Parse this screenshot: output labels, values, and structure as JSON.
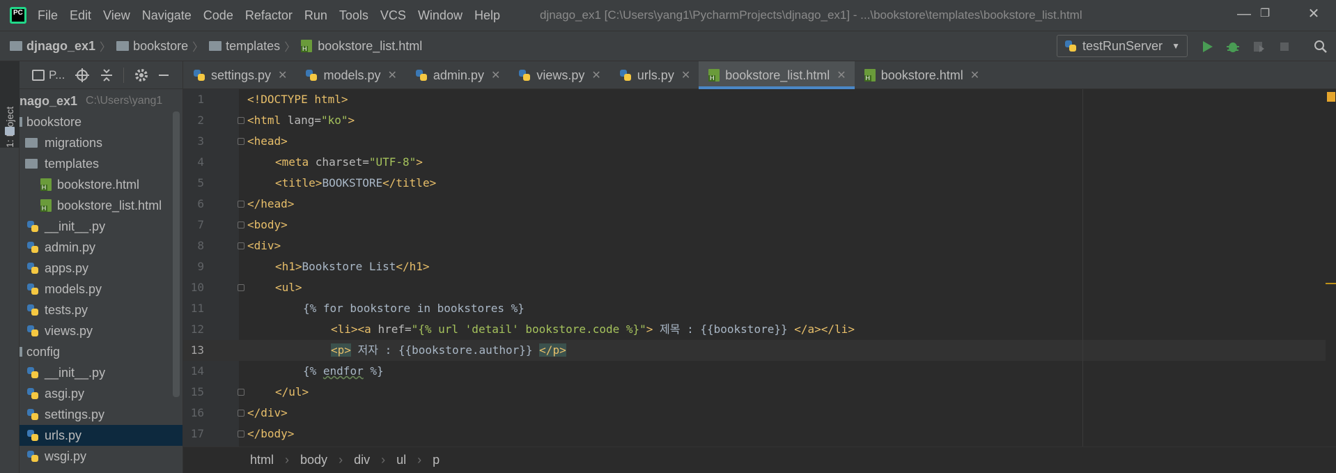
{
  "app": {
    "logo_text": "PC"
  },
  "menu": [
    "File",
    "Edit",
    "View",
    "Navigate",
    "Code",
    "Refactor",
    "Run",
    "Tools",
    "VCS",
    "Window",
    "Help"
  ],
  "window_title": "djnago_ex1 [C:\\Users\\yang1\\PycharmProjects\\djnago_ex1] - ...\\bookstore\\templates\\bookstore_list.html",
  "nav_breadcrumb": [
    "djnago_ex1",
    "bookstore",
    "templates",
    "bookstore_list.html"
  ],
  "run_config": "testRunServer",
  "project_panel": {
    "title": "P...",
    "side_tab": "1: Project",
    "root": {
      "name": "nago_ex1",
      "path": "C:\\Users\\yang1"
    },
    "items": [
      {
        "label": "bookstore",
        "type": "folder"
      },
      {
        "label": "migrations",
        "type": "folder"
      },
      {
        "label": "templates",
        "type": "folder"
      },
      {
        "label": "bookstore.html",
        "type": "html"
      },
      {
        "label": "bookstore_list.html",
        "type": "html"
      },
      {
        "label": "__init__.py",
        "type": "py"
      },
      {
        "label": "admin.py",
        "type": "py"
      },
      {
        "label": "apps.py",
        "type": "py"
      },
      {
        "label": "models.py",
        "type": "py"
      },
      {
        "label": "tests.py",
        "type": "py"
      },
      {
        "label": "views.py",
        "type": "py"
      },
      {
        "label": "config",
        "type": "folder"
      },
      {
        "label": "__init__.py",
        "type": "py"
      },
      {
        "label": "asgi.py",
        "type": "py"
      },
      {
        "label": "settings.py",
        "type": "py"
      },
      {
        "label": "urls.py",
        "type": "py"
      },
      {
        "label": "wsgi.py",
        "type": "py"
      }
    ]
  },
  "tabs": [
    {
      "label": "settings.py"
    },
    {
      "label": "models.py"
    },
    {
      "label": "admin.py"
    },
    {
      "label": "views.py"
    },
    {
      "label": "urls.py"
    },
    {
      "label": "bookstore_list.html"
    },
    {
      "label": "bookstore.html"
    }
  ],
  "line_numbers": [
    "1",
    "2",
    "3",
    "4",
    "5",
    "6",
    "7",
    "8",
    "9",
    "10",
    "11",
    "12",
    "13",
    "14",
    "15",
    "16",
    "17"
  ],
  "code": {
    "l1": "<!DOCTYPE html>",
    "l2a": "<html ",
    "l2b": "lang=",
    "l2c": "\"ko\"",
    "l2d": ">",
    "l3": "<head>",
    "l4a": "<meta ",
    "l4b": "charset=",
    "l4c": "\"UTF-8\"",
    "l4d": ">",
    "l5a": "<title>",
    "l5b": "BOOKSTORE",
    "l5c": "</title>",
    "l6": "</head>",
    "l7": "<body>",
    "l8": "<div>",
    "l9a": "<h1>",
    "l9b": "Bookstore List",
    "l9c": "</h1>",
    "l10": "<ul>",
    "l11": "{% for bookstore in bookstores %}",
    "l12a": "<li><a ",
    "l12b": "href=",
    "l12c": "\"{% url 'detail' bookstore.code %}\"",
    "l12d": ">",
    "l12e": " 제목 : {{bookstore}} ",
    "l12f": "</a></li>",
    "l13a": "<p>",
    "l13b": " 저자 : {{bookstore.author}} ",
    "l13c": "</p>",
    "l14a": "{% ",
    "l14b": "endfor",
    "l14c": " %}",
    "l15": "</ul>",
    "l16": "</div>",
    "l17": "</body>"
  },
  "status_breadcrumb": [
    "html",
    "body",
    "div",
    "ul",
    "p"
  ]
}
